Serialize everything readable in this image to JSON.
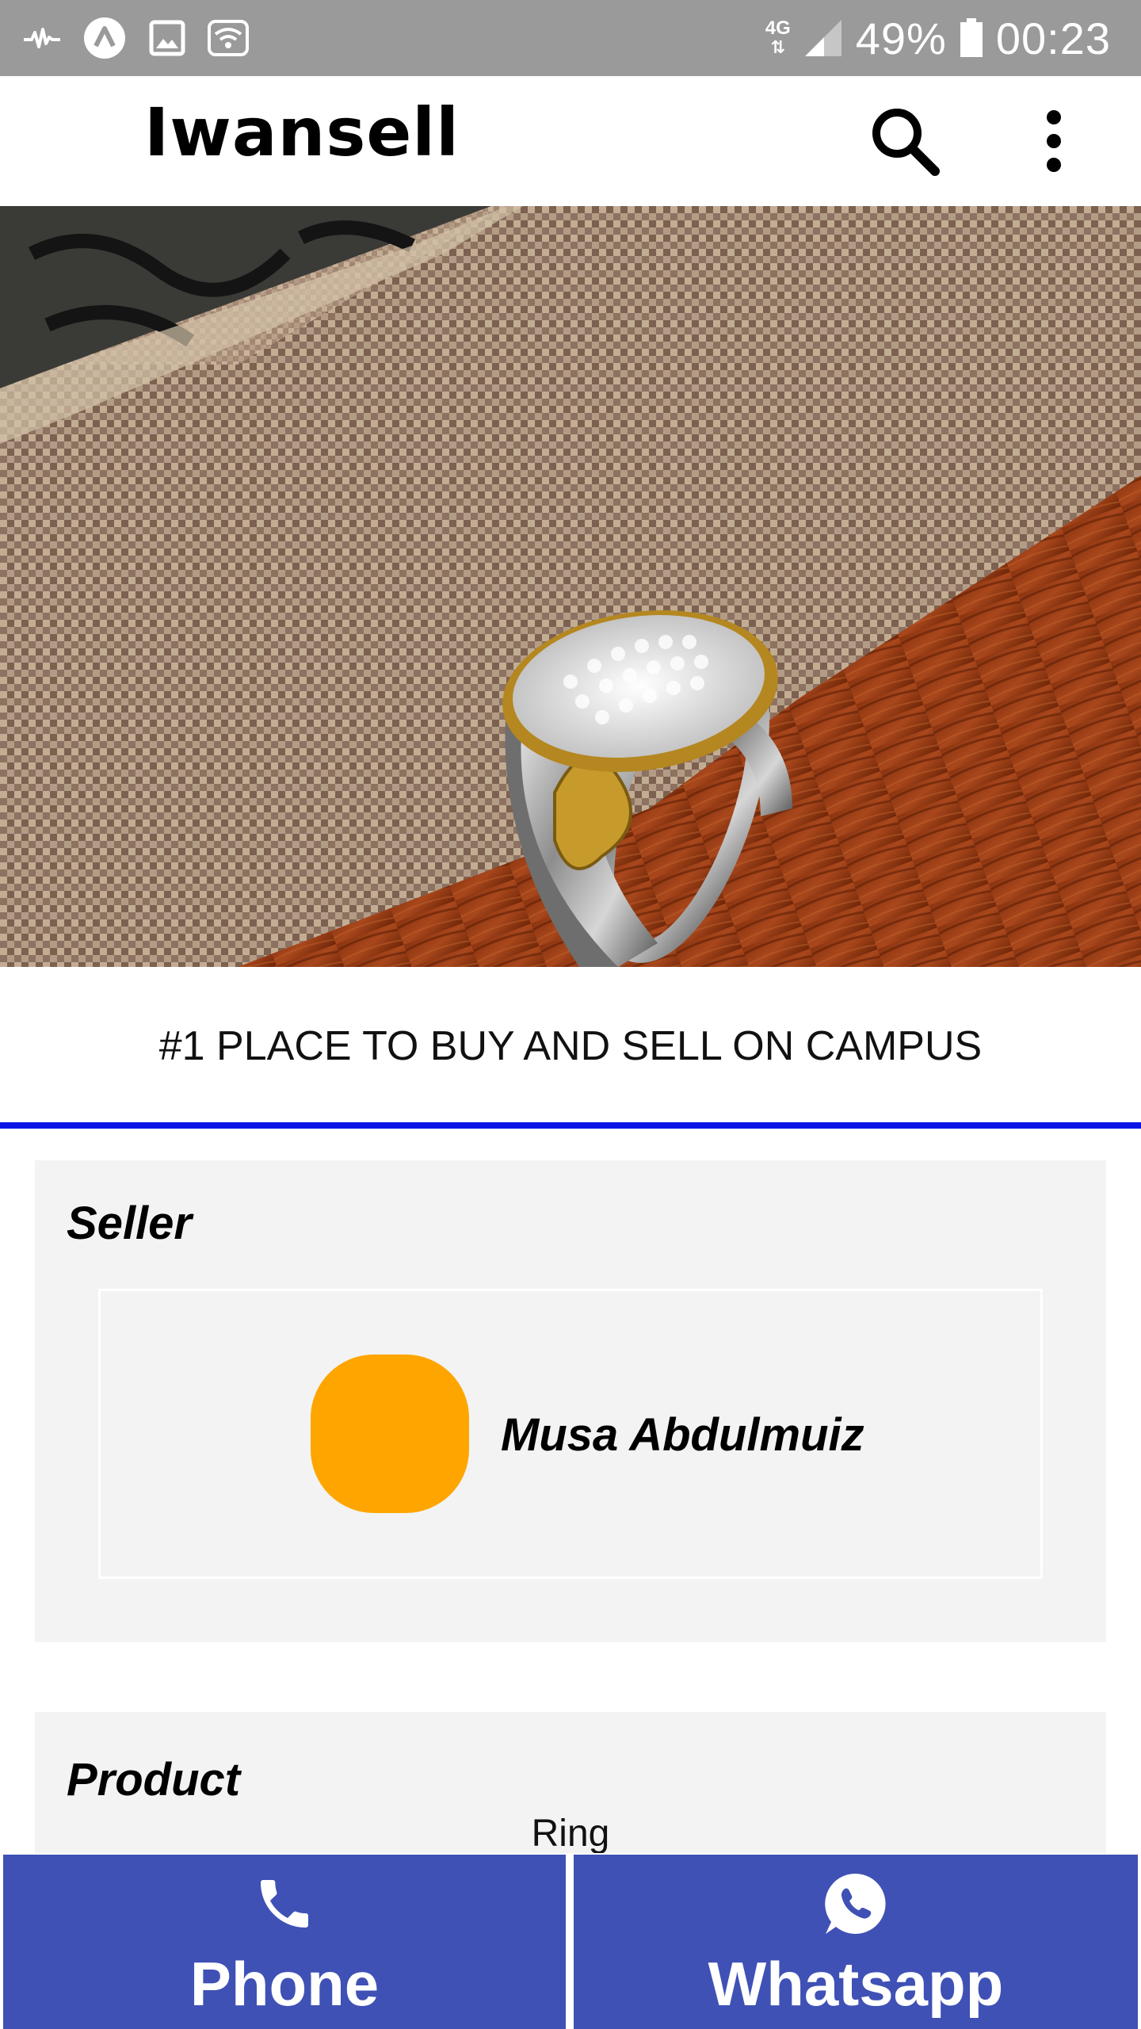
{
  "status_bar": {
    "icons_left": [
      "activity-icon",
      "app-a-icon",
      "image-icon",
      "wifi-icon"
    ],
    "network": "4G",
    "battery": "49%",
    "time": "00:23"
  },
  "app_bar": {
    "title": "Iwansell",
    "search_icon": "search-icon",
    "menu_icon": "more-vert-icon"
  },
  "hero": {
    "description_icon": "product-photo"
  },
  "tagline": "#1 PLACE TO BUY AND SELL ON CAMPUS",
  "seller": {
    "heading": "Seller",
    "name": "Musa Abdulmuiz",
    "avatar_color": "#ffa500"
  },
  "product": {
    "heading": "Product",
    "name": "Ring"
  },
  "actions": {
    "phone_label": "Phone",
    "whatsapp_label": "Whatsapp",
    "button_color": "#3f51b5"
  },
  "colors": {
    "status_bar": "#9a9a9a",
    "divider": "#0a14e6",
    "card_bg": "#f3f3f3"
  }
}
